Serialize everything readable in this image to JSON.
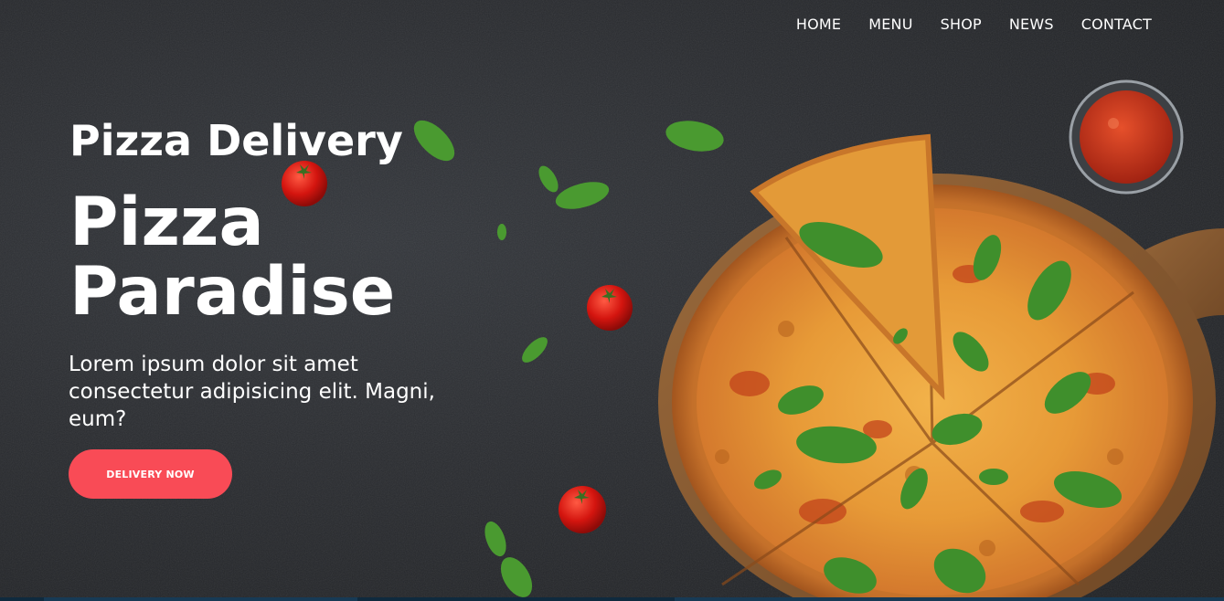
{
  "nav": {
    "items": [
      {
        "label": "HOME"
      },
      {
        "label": "MENU"
      },
      {
        "label": "SHOP"
      },
      {
        "label": "NEWS"
      },
      {
        "label": "CONTACT"
      }
    ]
  },
  "hero": {
    "subtitle": "Pizza Delivery",
    "title": "Pizza Paradise",
    "description": "Lorem ipsum dolor sit amet consectetur adipisicing elit. Magni, eum?",
    "cta_label": "DELIVERY NOW"
  },
  "colors": {
    "accent": "#f94b56",
    "background": "#2a2c30",
    "text": "#ffffff"
  }
}
